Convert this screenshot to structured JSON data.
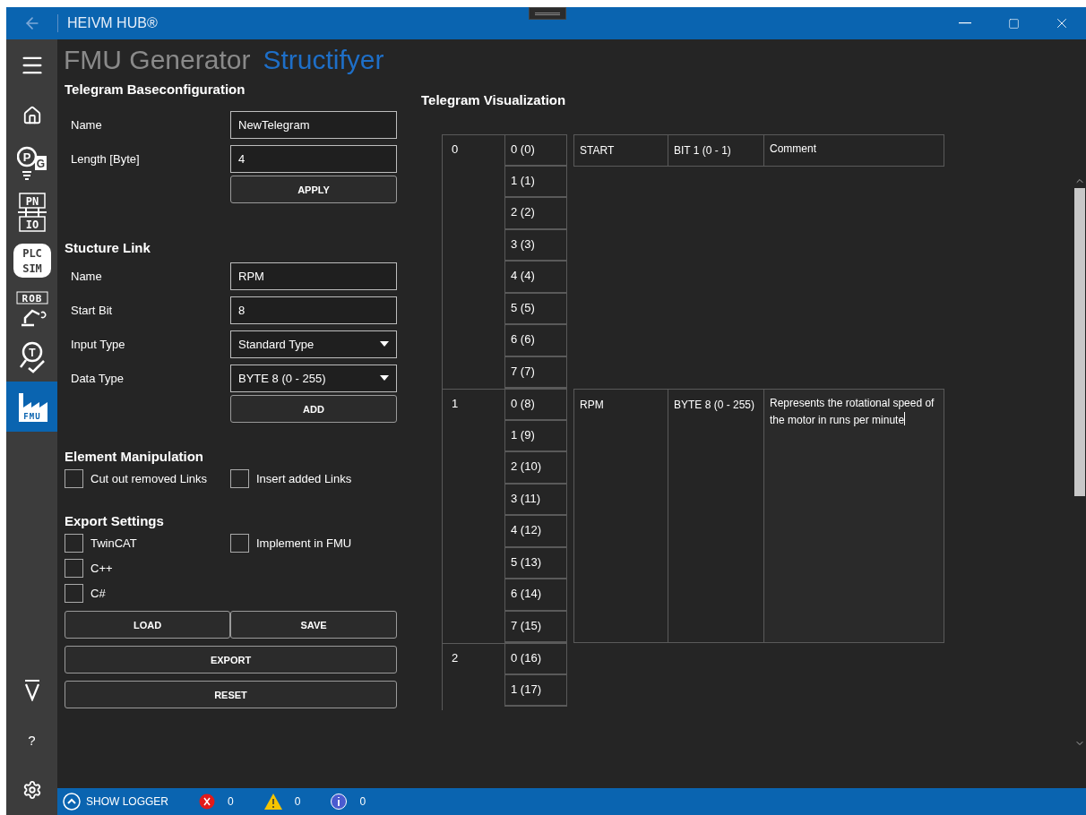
{
  "window": {
    "title": "HEIVM HUB®"
  },
  "header": {
    "title": "FMU Generator",
    "subtitle": "Structifyer"
  },
  "sidebar": {
    "items": [
      {
        "kind": "home",
        "selected": false
      },
      {
        "kind": "bulb",
        "lines": [
          "P",
          "G"
        ],
        "selected": false
      },
      {
        "kind": "net",
        "lines": [
          "PN",
          "IO"
        ],
        "selected": false
      },
      {
        "kind": "plc",
        "lines": [
          "PLC",
          "SIM"
        ],
        "selected": false
      },
      {
        "kind": "robot",
        "lines": [
          "ROB"
        ],
        "selected": false
      },
      {
        "kind": "test",
        "lines": [
          "T"
        ],
        "selected": false
      },
      {
        "kind": "factory",
        "lines": [
          "FMU"
        ],
        "selected": true
      }
    ],
    "help": "?"
  },
  "base_config": {
    "heading": "Telegram Baseconfiguration",
    "fields": [
      {
        "kind": "text",
        "label": "Name",
        "value": "NewTelegram"
      },
      {
        "kind": "text",
        "label": "Length [Byte]",
        "value": "4"
      }
    ],
    "button": "APPLY"
  },
  "structure_link": {
    "heading": "Stucture Link",
    "fields": [
      {
        "kind": "text",
        "label": "Name",
        "value": "RPM"
      },
      {
        "kind": "text",
        "label": "Start Bit",
        "value": "8"
      },
      {
        "kind": "select",
        "label": "Input Type",
        "value": "Standard Type"
      },
      {
        "kind": "select",
        "label": "Data Type",
        "value": "BYTE 8 (0 - 255)"
      }
    ],
    "button": "ADD"
  },
  "element_manipulation": {
    "heading": "Element Manipulation",
    "options": [
      {
        "label": "Cut out removed Links",
        "checked": false
      },
      {
        "label": "Insert added Links",
        "checked": false
      }
    ]
  },
  "export_settings": {
    "heading": "Export Settings",
    "options": [
      {
        "label": "TwinCAT",
        "checked": false
      },
      {
        "label": "C++",
        "checked": false
      },
      {
        "label": "C#",
        "checked": false
      },
      {
        "label": "Implement in FMU",
        "checked": false
      }
    ],
    "buttons": [
      "LOAD",
      "SAVE",
      "EXPORT",
      "RESET"
    ]
  },
  "visualization": {
    "heading": "Telegram Visualization",
    "bytes": [
      {
        "label": "0",
        "bits": [
          {
            "label": "0 (0)",
            "link": {
              "kind": "bit",
              "name": "START",
              "type": "BIT 1 (0 - 1)",
              "comment": "Comment",
              "editing": false
            }
          },
          {
            "label": "1 (1)"
          },
          {
            "label": "2 (2)"
          },
          {
            "label": "3 (3)"
          },
          {
            "label": "4 (4)"
          },
          {
            "label": "5 (5)"
          },
          {
            "label": "6 (6)"
          },
          {
            "label": "7 (7)"
          }
        ]
      },
      {
        "label": "1",
        "bits": [
          {
            "label": "0 (8)",
            "link": {
              "kind": "byte",
              "name": "RPM",
              "type": "BYTE 8 (0 - 255)",
              "comment": "Represents the rotational speed of the motor in runs per minute",
              "editing": true
            }
          },
          {
            "label": "1 (9)"
          },
          {
            "label": "2 (10)"
          },
          {
            "label": "3 (11)"
          },
          {
            "label": "4 (12)"
          },
          {
            "label": "5 (13)"
          },
          {
            "label": "6 (14)"
          },
          {
            "label": "7 (15)"
          }
        ]
      },
      {
        "label": "2",
        "bits": [
          {
            "label": "0 (16)"
          },
          {
            "label": "1 (17)"
          }
        ]
      }
    ]
  },
  "status_bar": {
    "logger": "SHOW LOGGER",
    "errors": "0",
    "warnings": "0",
    "infos": "0"
  }
}
